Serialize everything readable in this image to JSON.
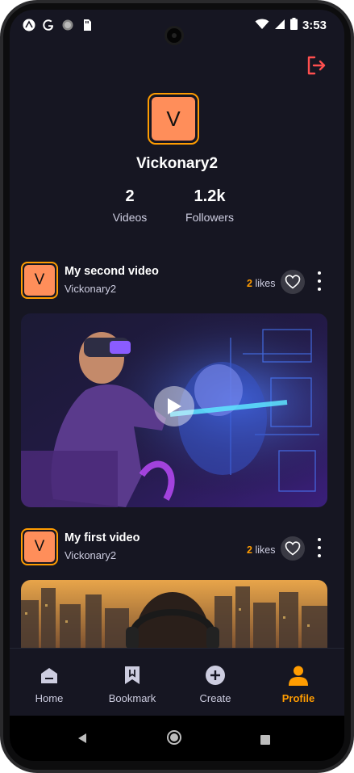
{
  "status_bar": {
    "time": "3:53",
    "left_icons": [
      "expo-icon",
      "google-icon",
      "record-dot-icon",
      "sim-icon"
    ],
    "right_icons": [
      "wifi-icon",
      "signal-icon",
      "battery-icon"
    ]
  },
  "header": {
    "logout_icon": "logout-icon"
  },
  "profile": {
    "avatar_letter": "V",
    "username": "Vickonary2",
    "stats": [
      {
        "value": "2",
        "label": "Videos"
      },
      {
        "value": "1.2k",
        "label": "Followers"
      }
    ]
  },
  "posts": [
    {
      "avatar_letter": "V",
      "title": "My second video",
      "author": "Vickonary2",
      "likes_count": "2",
      "likes_label": "likes"
    },
    {
      "avatar_letter": "V",
      "title": "My first video",
      "author": "Vickonary2",
      "likes_count": "2",
      "likes_label": "likes"
    }
  ],
  "tabs": [
    {
      "label": "Home",
      "icon": "home-icon",
      "active": false
    },
    {
      "label": "Bookmark",
      "icon": "bookmark-icon",
      "active": false
    },
    {
      "label": "Create",
      "icon": "plus-circle-icon",
      "active": false
    },
    {
      "label": "Profile",
      "icon": "person-icon",
      "active": true
    }
  ],
  "colors": {
    "background": "#161622",
    "accent": "#ff9c01",
    "avatar_fill": "#ff8e5a",
    "logout": "#ff4f4f",
    "secondary_text": "#cdcde0"
  }
}
